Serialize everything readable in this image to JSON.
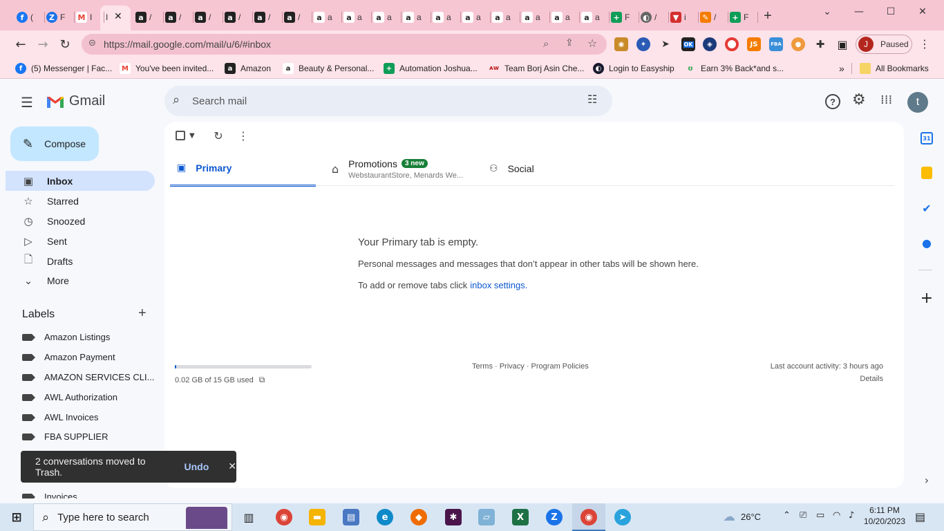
{
  "browser": {
    "tab_titles": [
      "(",
      "F",
      "I",
      "I",
      "/",
      "/",
      "/",
      "/",
      "/",
      "/",
      "a",
      "a",
      "a",
      "a",
      "a",
      "a",
      "a",
      "a",
      "a",
      "a",
      "F",
      "/",
      "i",
      "/",
      "F"
    ],
    "active_tab_label": "I",
    "new_tab": "+",
    "url": "https://mail.google.com/mail/u/6/#inbox",
    "profile_initial": "J",
    "profile_status": "Paused",
    "bookmarks": [
      "(5) Messenger | Fac...",
      "You've been invited...",
      "Amazon",
      "Beauty & Personal...",
      "Automation Joshua...",
      "Team Borj Asin Che...",
      "Login to Easyship",
      "Earn 3% Back*and s..."
    ],
    "bookmarks_more": "»",
    "all_bookmarks": "All Bookmarks",
    "ext_badge": "OK",
    "ext_js": "JS",
    "ext_fba": "FBA"
  },
  "gmail": {
    "logo_text": "Gmail",
    "search_placeholder": "Search mail",
    "avatar_initial": "t",
    "compose_label": "Compose",
    "nav": [
      {
        "label": "Inbox",
        "icon": "inbox-icon"
      },
      {
        "label": "Starred",
        "icon": "star-icon"
      },
      {
        "label": "Snoozed",
        "icon": "clock-icon"
      },
      {
        "label": "Sent",
        "icon": "send-icon"
      },
      {
        "label": "Drafts",
        "icon": "draft-icon"
      },
      {
        "label": "More",
        "icon": "chevron-down-icon"
      }
    ],
    "labels_heading": "Labels",
    "labels": [
      "Amazon Listings",
      "Amazon Payment",
      "AMAZON SERVICES CLI...",
      "AWL Authorization",
      "AWL Invoices",
      "FBA SUPPLIER",
      "Invoices"
    ],
    "tabs": [
      {
        "label": "Primary"
      },
      {
        "label": "Promotions",
        "badge": "3 new",
        "subtitle": "WebstaurantStore, Menards We..."
      },
      {
        "label": "Social"
      }
    ],
    "empty_title": "Your Primary tab is empty.",
    "empty_desc": "Personal messages and messages that don’t appear in other tabs will be shown here.",
    "empty_settings_prefix": "To add or remove tabs click",
    "empty_settings_link": "inbox settings.",
    "storage_used": "0.02 GB of 15 GB used",
    "storage_fraction": 0.0013,
    "footer_links": "Terms · Privacy · Program Policies",
    "last_activity": "Last account activity: 3 hours ago",
    "details": "Details",
    "snackbar_text": "2 conversations moved to Trash.",
    "snackbar_action": "Undo",
    "calendar_date": "31"
  },
  "taskbar": {
    "search_placeholder": "Type here to search",
    "weather": "26°C",
    "time": "6:11 PM",
    "date": "10/20/2023"
  },
  "colors": {
    "tab_strip": "#f7c6d3",
    "toolbar": "#fde3ea",
    "gmail_accent": "#0b57d0",
    "selected_nav": "#d3e3fd",
    "compose_bg": "#c2e7ff",
    "promo_badge": "#188038"
  }
}
